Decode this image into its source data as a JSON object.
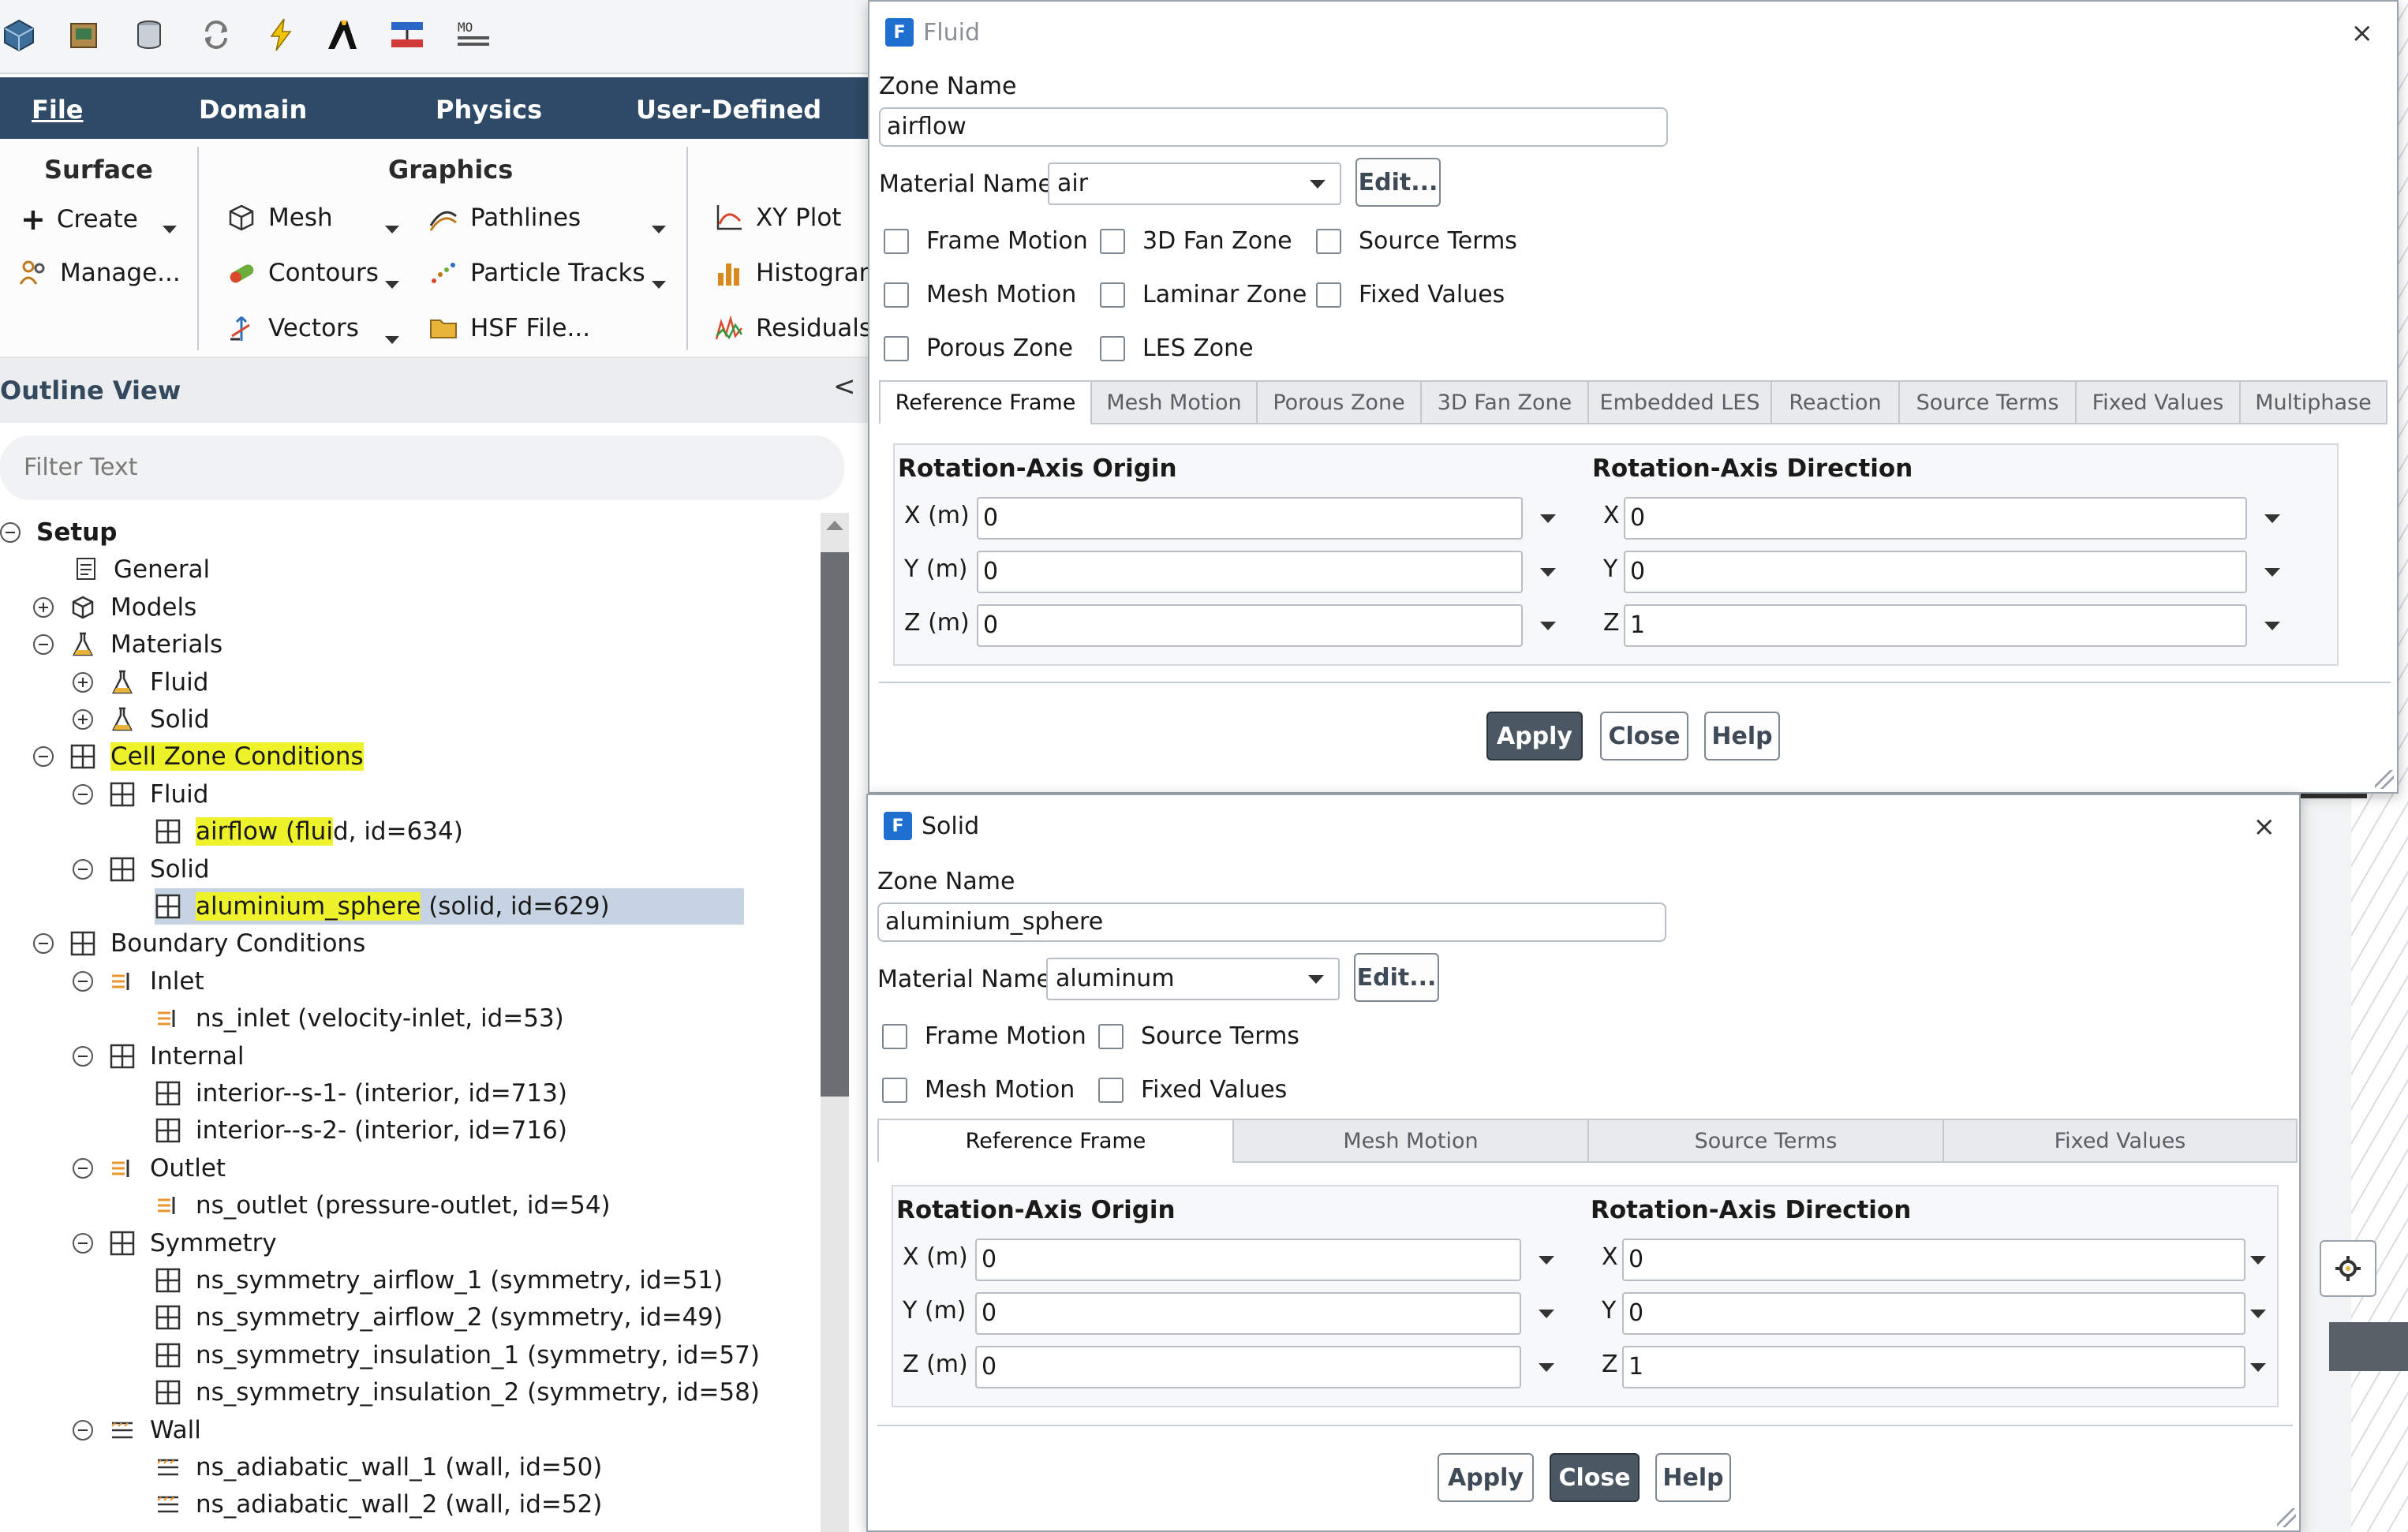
{
  "menubar": {
    "items": [
      "File",
      "Domain",
      "Physics",
      "User-Defined"
    ]
  },
  "toolbar": {
    "icons": [
      "mesh-display-icon",
      "package-icon",
      "cylinder-icon",
      "refresh-icon",
      "lightning-icon",
      "ansys-logo-icon",
      "transform-icon",
      "mdi-icon"
    ]
  },
  "ribbon": {
    "surface": {
      "title": "Surface",
      "create": "Create",
      "manage": "Manage..."
    },
    "graphics": {
      "title": "Graphics",
      "mesh": "Mesh",
      "contours": "Contours",
      "vectors": "Vectors",
      "pathlines": "Pathlines",
      "particle_tracks": "Particle Tracks",
      "hsf_file": "HSF File..."
    },
    "plots": {
      "xy_plot": "XY Plot",
      "histogram": "Histogram",
      "residuals": "Residuals"
    }
  },
  "outline": {
    "title": "Outline View",
    "collapse": "<",
    "filter_placeholder": "Filter Text"
  },
  "tree": {
    "setup": "Setup",
    "general": "General",
    "models": "Models",
    "materials": "Materials",
    "mat_fluid": "Fluid",
    "mat_solid": "Solid",
    "cell_zone": "Cell Zone Conditions",
    "cz_fluid": "Fluid",
    "airflow_a": "airflow (flui",
    "airflow_b": "d, id=634)",
    "cz_solid": "Solid",
    "sphere_a": "aluminium_sphere",
    "sphere_b": " (solid, id=629)",
    "boundary": "Boundary Conditions",
    "inlet": "Inlet",
    "ns_inlet": "ns_inlet (velocity-inlet, id=53)",
    "internal": "Internal",
    "interior1": "interior--s-1- (interior, id=713)",
    "interior2": "interior--s-2- (interior, id=716)",
    "outlet": "Outlet",
    "ns_outlet": "ns_outlet (pressure-outlet, id=54)",
    "symmetry": "Symmetry",
    "sym1": "ns_symmetry_airflow_1 (symmetry, id=51)",
    "sym2": "ns_symmetry_airflow_2 (symmetry, id=49)",
    "sym3": "ns_symmetry_insulation_1 (symmetry, id=57)",
    "sym4": "ns_symmetry_insulation_2 (symmetry, id=58)",
    "wall": "Wall",
    "wall1": "ns_adiabatic_wall_1 (wall, id=50)",
    "wall2": "ns_adiabatic_wall_2 (wall, id=52)"
  },
  "fluid_dialog": {
    "title": "Fluid",
    "close_icon": "×",
    "zone_name_label": "Zone Name",
    "zone_name": "airflow",
    "material_label": "Material Name",
    "material": "air",
    "edit": "Edit...",
    "checkboxes": [
      "Frame Motion",
      "3D Fan Zone",
      "Source Terms",
      "Mesh Motion",
      "Laminar Zone",
      "Fixed Values",
      "Porous Zone",
      "LES Zone"
    ],
    "tabs": [
      "Reference Frame",
      "Mesh Motion",
      "Porous Zone",
      "3D Fan Zone",
      "Embedded LES",
      "Reaction",
      "Source Terms",
      "Fixed Values",
      "Multiphase"
    ],
    "origin_title": "Rotation-Axis Origin",
    "direction_title": "Rotation-Axis Direction",
    "x_label": "X (m)",
    "y_label": "Y (m)",
    "z_label": "Z (m)",
    "dx_label": "X",
    "dy_label": "Y",
    "dz_label": "Z",
    "ox": "0",
    "oy": "0",
    "oz": "0",
    "dx": "0",
    "dy": "0",
    "dz": "1",
    "apply": "Apply",
    "close": "Close",
    "help": "Help"
  },
  "solid_dialog": {
    "title": "Solid",
    "close_icon": "×",
    "zone_name_label": "Zone Name",
    "zone_name": "aluminium_sphere",
    "material_label": "Material Name",
    "material": "aluminum",
    "edit": "Edit...",
    "checkboxes": [
      "Frame Motion",
      "Source Terms",
      "Mesh Motion",
      "Fixed Values"
    ],
    "tabs": [
      "Reference Frame",
      "Mesh Motion",
      "Source Terms",
      "Fixed Values"
    ],
    "origin_title": "Rotation-Axis Origin",
    "direction_title": "Rotation-Axis Direction",
    "x_label": "X (m)",
    "y_label": "Y (m)",
    "z_label": "Z (m)",
    "dx_label": "X",
    "dy_label": "Y",
    "dz_label": "Z",
    "ox": "0",
    "oy": "0",
    "oz": "0",
    "dx": "0",
    "dy": "0",
    "dz": "1",
    "apply": "Apply",
    "close": "Close",
    "help": "Help"
  },
  "colors": {
    "menubar": "#2e4a66",
    "highlight": "#eef22a",
    "selection": "#c5d3e2",
    "primary_button": "#4b5763"
  }
}
